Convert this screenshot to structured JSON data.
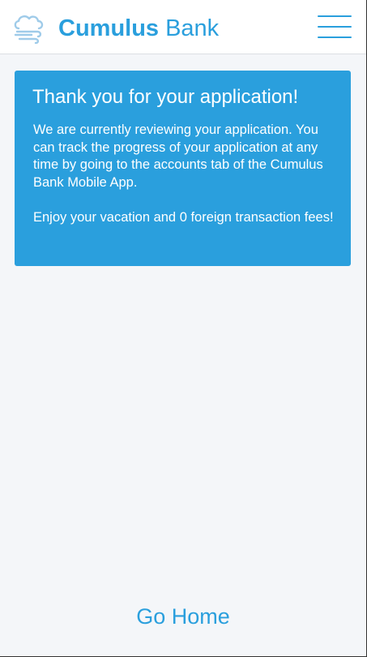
{
  "header": {
    "logo_icon": "cloud-wind-icon",
    "brand_primary": "Cumulus",
    "brand_secondary": "Bank",
    "menu_icon": "hamburger-menu-icon"
  },
  "confirmation": {
    "title": "Thank you for your application!",
    "message": "We are currently reviewing your application. You can track the progress of your application at any time by going to the accounts tab of the Cumulus Bank Mobile App.",
    "note": "Enjoy your vacation and 0 foreign transaction fees!"
  },
  "footer": {
    "go_home_label": "Go Home"
  },
  "colors": {
    "accent": "#2a9fdd",
    "background": "#f4f6f9",
    "header_bg": "#ffffff",
    "card_text": "#ffffff"
  }
}
